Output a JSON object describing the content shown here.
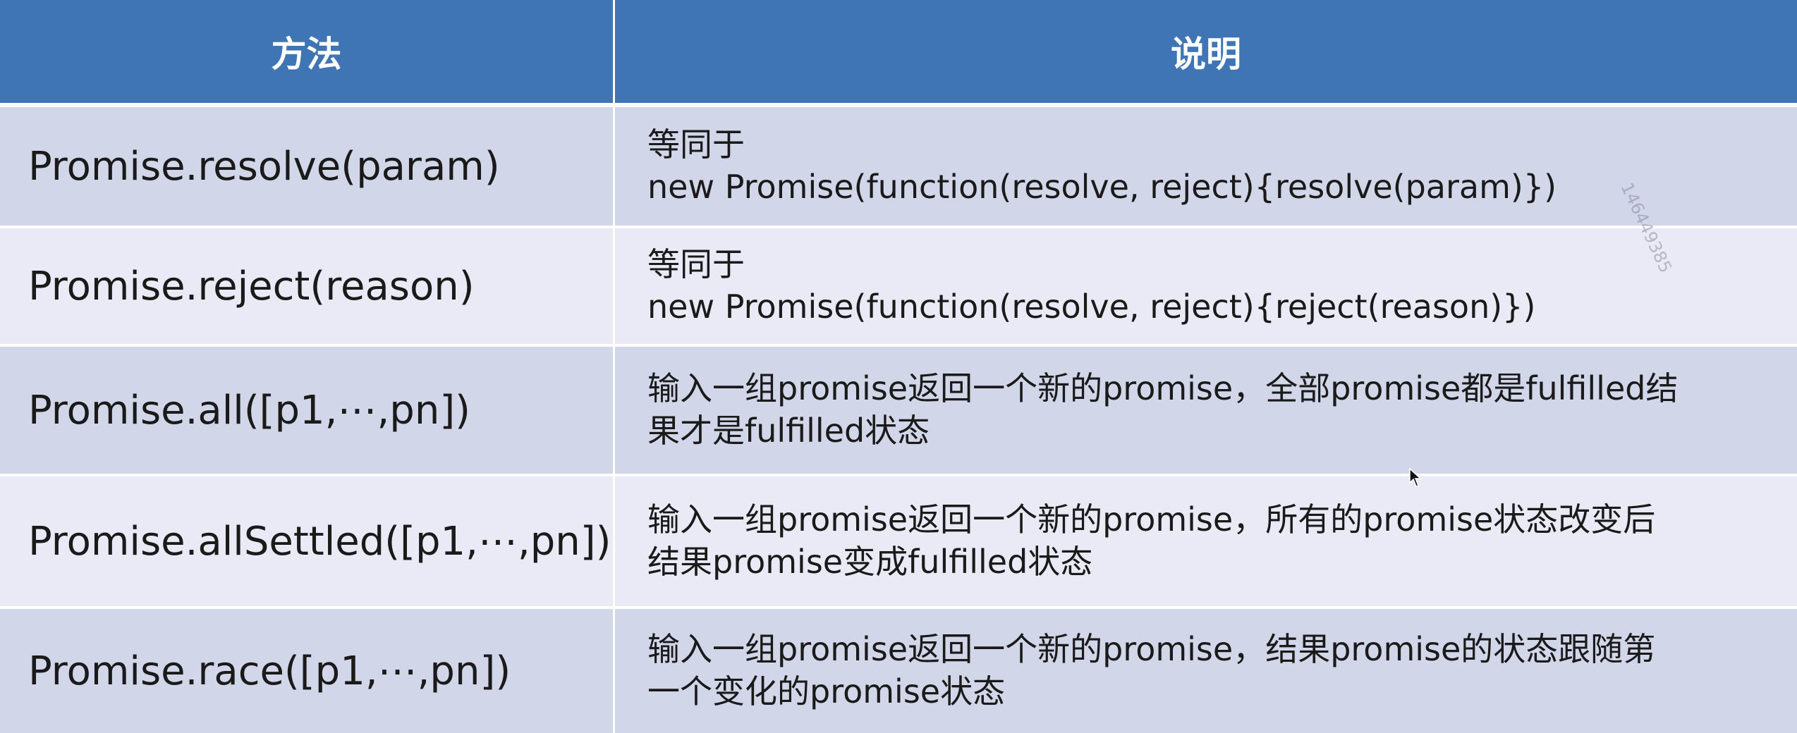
{
  "table": {
    "headers": {
      "method": "方法",
      "description": "说明"
    },
    "rows": [
      {
        "method": "Promise.resolve(param)",
        "description": [
          "等同于",
          "new Promise(function(resolve, reject){resolve(param)})"
        ]
      },
      {
        "method": "Promise.reject(reason)",
        "description": [
          "等同于",
          "new Promise(function(resolve, reject){reject(reason)})"
        ]
      },
      {
        "method": "Promise.all([p1,⋯,pn])",
        "description": [
          "输入一组promise返回一个新的promise，全部promise都是fulfilled结",
          "果才是fulfilled状态"
        ]
      },
      {
        "method": "Promise.allSettled([p1,⋯,pn])",
        "description": [
          "输入一组promise返回一个新的promise，所有的promise状态改变后",
          "结果promise变成fulfilled状态"
        ]
      },
      {
        "method": "Promise.race([p1,⋯,pn])",
        "description": [
          "输入一组promise返回一个新的promise，结果promise的状态跟随第",
          "一个变化的promise状态"
        ]
      }
    ]
  },
  "watermark": "146449385",
  "colors": {
    "header_bg": "#3f74b5",
    "row_odd_bg": "#d1d6e9",
    "row_even_bg": "#e9eaf5",
    "text": "#1a1a1a"
  },
  "icons": {
    "cursor": "mouse-pointer-icon"
  }
}
